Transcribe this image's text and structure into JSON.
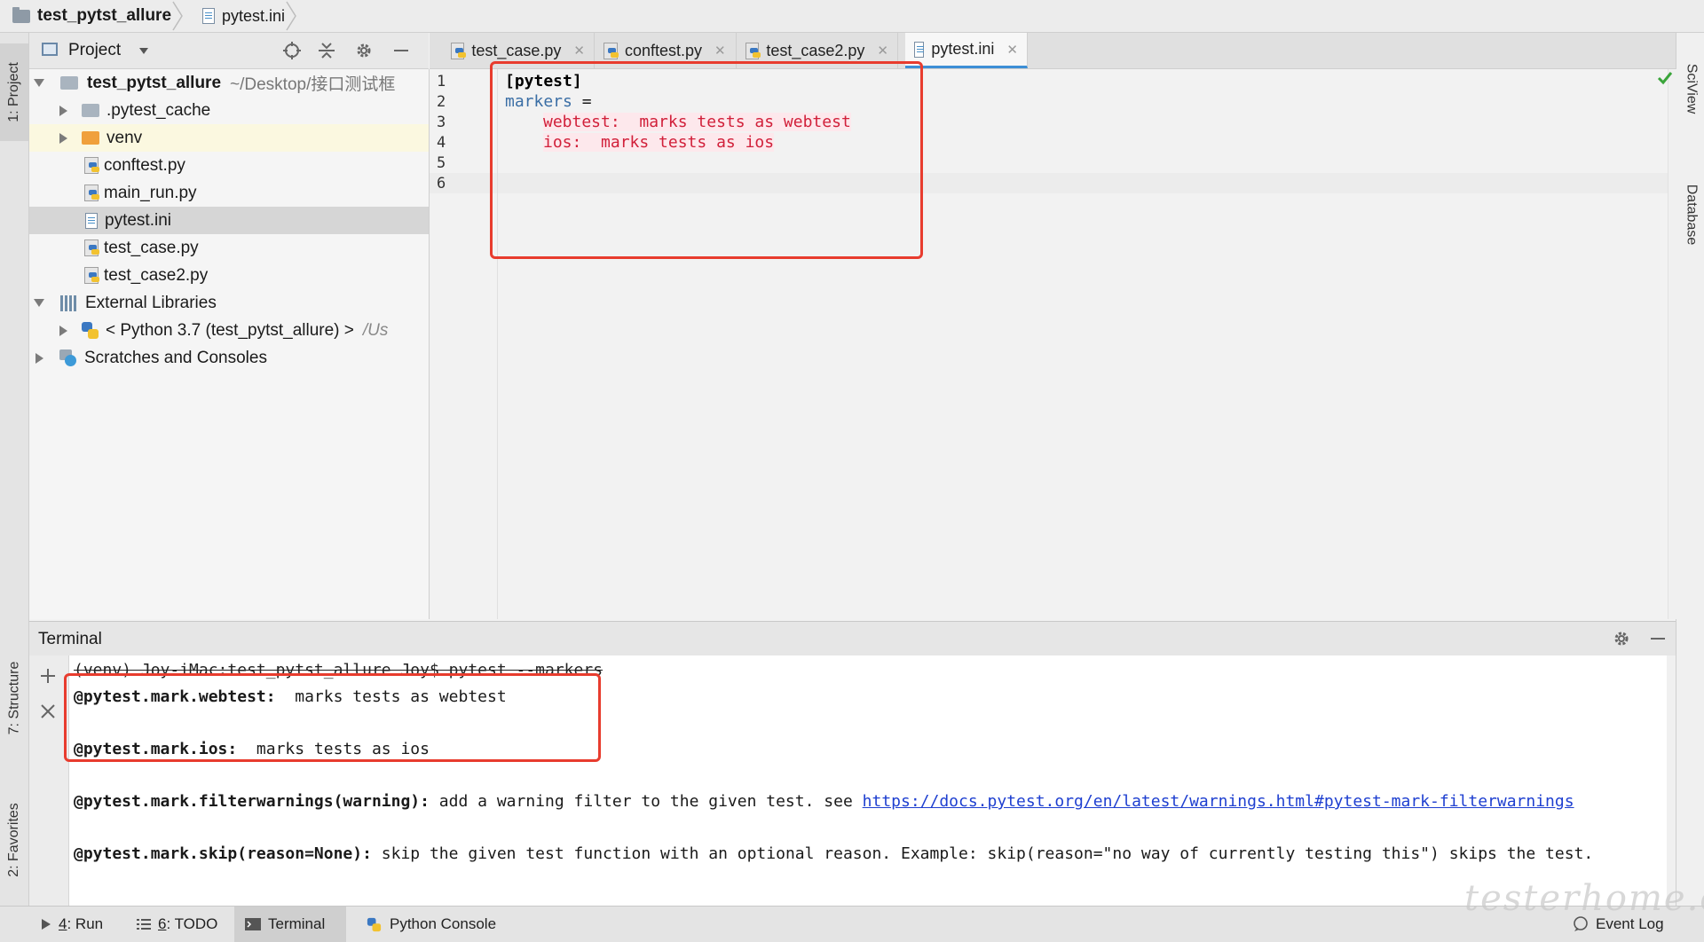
{
  "breadcrumb": {
    "project": "test_pytst_allure",
    "file": "pytest.ini"
  },
  "left_strip": {
    "project_tab": "1: Project",
    "structure_tab": "7: Structure",
    "favorites_tab": "2: Favorites"
  },
  "right_strip": {
    "sciview_tab": "SciView",
    "database_tab": "Database"
  },
  "project_panel": {
    "title": "Project",
    "tree": [
      {
        "label": "test_pytst_allure",
        "suffix": "~/Desktop/接口测试框",
        "icon": "folder-icon"
      },
      {
        "label": ".pytest_cache",
        "icon": "folder-icon"
      },
      {
        "label": "venv",
        "icon": "folder-orange-icon"
      },
      {
        "label": "conftest.py",
        "icon": "python-file-icon"
      },
      {
        "label": "main_run.py",
        "icon": "python-file-icon"
      },
      {
        "label": "pytest.ini",
        "icon": "ini-file-icon"
      },
      {
        "label": "test_case.py",
        "icon": "python-file-icon"
      },
      {
        "label": "test_case2.py",
        "icon": "python-file-icon"
      },
      {
        "label": "External Libraries",
        "icon": "libraries-icon"
      },
      {
        "label": "< Python 3.7 (test_pytst_allure) >",
        "suffix": "/Us",
        "icon": "python-icon"
      },
      {
        "label": "Scratches and Consoles",
        "icon": "scratches-icon"
      }
    ]
  },
  "editor": {
    "tabs": [
      {
        "label": "test_case.py"
      },
      {
        "label": "conftest.py"
      },
      {
        "label": "test_case2.py"
      },
      {
        "label": "pytest.ini"
      }
    ],
    "line_numbers": [
      "1",
      "2",
      "3",
      "4",
      "5",
      "6"
    ],
    "lines": {
      "l1": "[pytest]",
      "l2_key": "markers",
      "l2_eq": " =",
      "l3": "webtest:  marks tests as webtest",
      "l4": "ios:  marks tests as ios"
    }
  },
  "terminal": {
    "title": "Terminal",
    "prompt": "(venv) Joy-iMac:test_pytst_allure Joy$ pytest --markers",
    "m1_name": "@pytest.mark.webtest:",
    "m1_desc": "  marks tests as webtest",
    "m2_name": "@pytest.mark.ios:",
    "m2_desc": "  marks tests as ios",
    "m3_name": "@pytest.mark.filterwarnings(warning):",
    "m3_desc": " add a warning filter to the given test. see ",
    "m3_link": "https://docs.pytest.org/en/latest/warnings.html#pytest-mark-filterwarnings",
    "m4_name": "@pytest.mark.skip(reason=None):",
    "m4_desc": " skip the given test function with an optional reason. Example: skip(reason=\"no way of currently testing this\") skips the test."
  },
  "bottom_bar": {
    "run_num": "4",
    "run_label": ": Run",
    "todo_num": "6",
    "todo_label": ": TODO",
    "terminal_label": "Terminal",
    "python_console_label": "Python Console",
    "event_log_label": "Event Log"
  },
  "watermark": "testerhome.com",
  "colors": {
    "annotation_box": "#e83c2e",
    "error_text": "#d1203a",
    "link": "#1e3fd0",
    "active_tab_accent": "#3d8fd6"
  }
}
